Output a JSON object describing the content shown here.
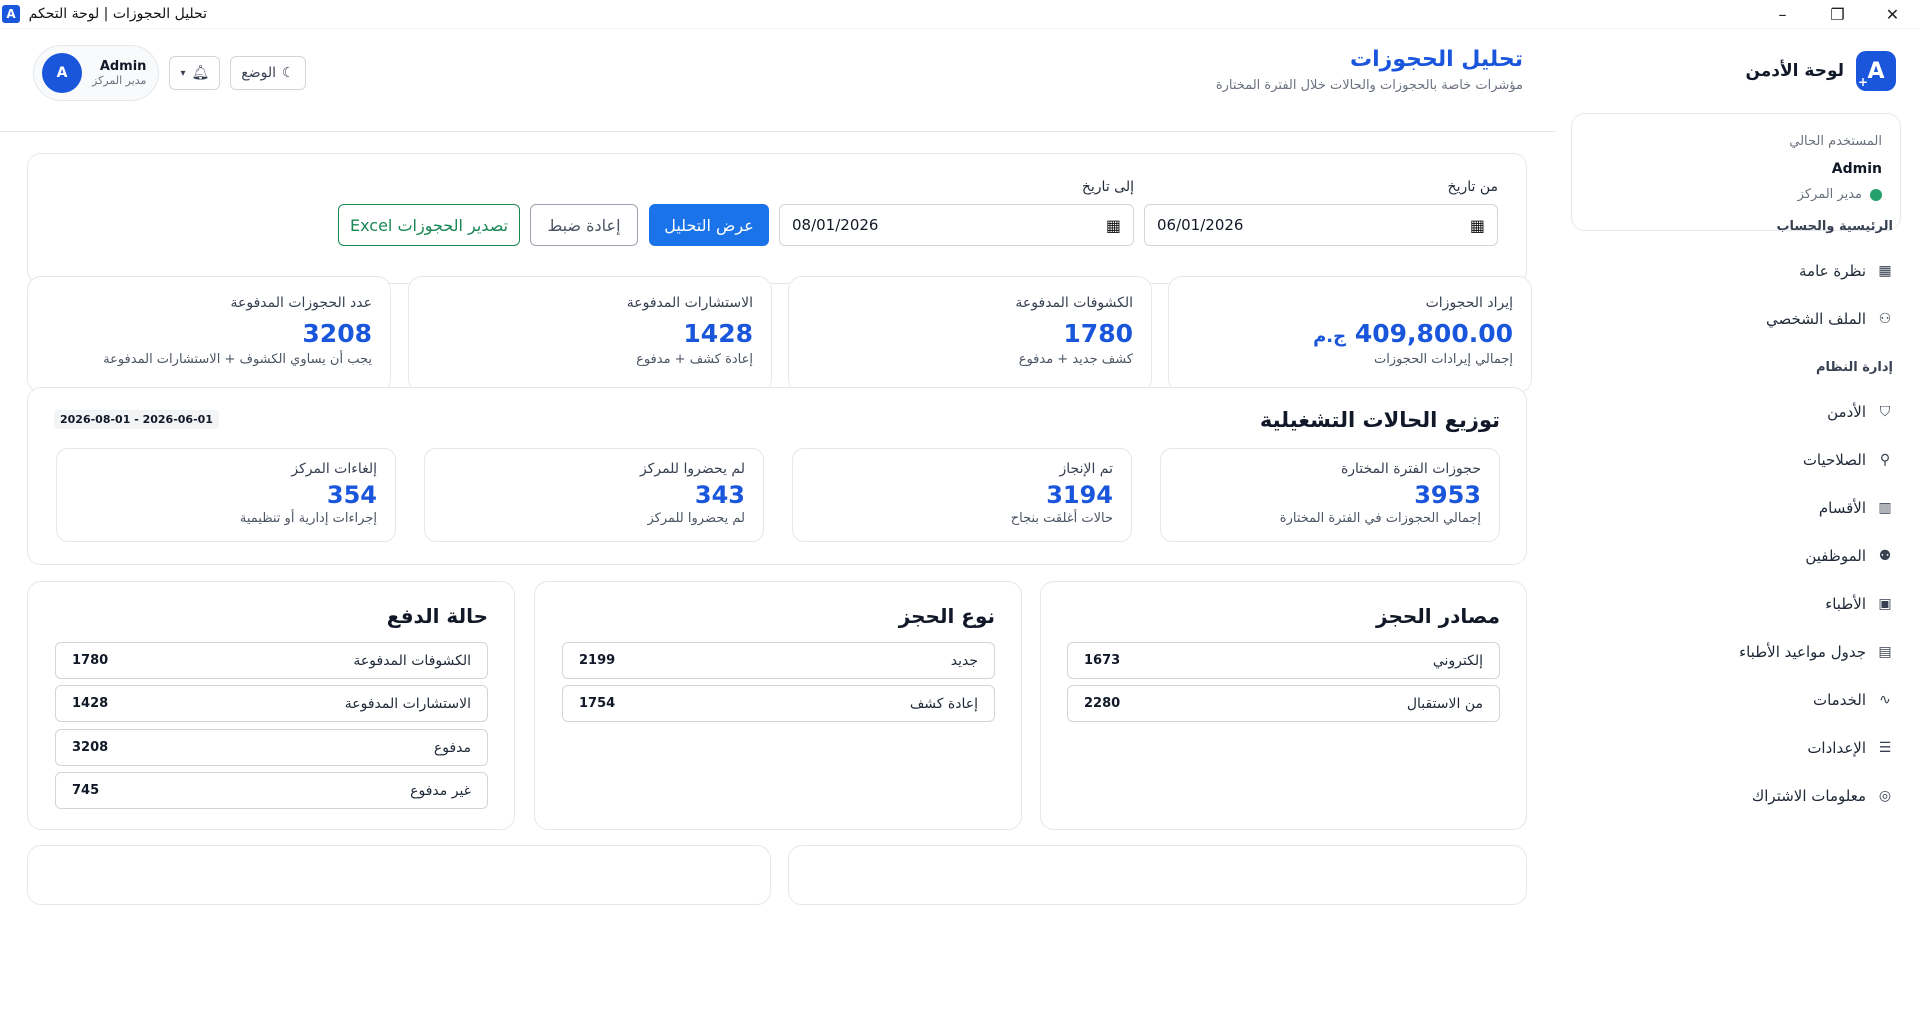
{
  "window": {
    "title": "تحليل الحجوزات | لوحة التحكم",
    "app_icon": "A",
    "minimize": "–",
    "restore": "❐",
    "close": "✕"
  },
  "sidebar": {
    "brand": "لوحة الأدمن",
    "brand_logo": "A",
    "brand_logo_plus": "+",
    "user_card": {
      "label": "المستخدم الحالي",
      "name": "Admin",
      "role": "مدير المركز"
    },
    "sections": [
      {
        "title": "الرئيسية والحساب"
      },
      {
        "title": "إدارة النظام"
      }
    ],
    "items": [
      {
        "label": "نظرة عامة",
        "icon": "grid-icon"
      },
      {
        "label": "الملف الشخصي",
        "icon": "user-icon"
      },
      {
        "label": "الأدمن",
        "icon": "shield-icon"
      },
      {
        "label": "الصلاحيات",
        "icon": "hierarchy-icon"
      },
      {
        "label": "الأقسام",
        "icon": "building-icon"
      },
      {
        "label": "الموظفين",
        "icon": "users-icon"
      },
      {
        "label": "الأطباء",
        "icon": "id-badge-icon"
      },
      {
        "label": "جدول مواعيد الأطباء",
        "icon": "calendar-icon"
      },
      {
        "label": "الخدمات",
        "icon": "pulse-icon"
      },
      {
        "label": "الإعدادات",
        "icon": "sliders-icon"
      },
      {
        "label": "معلومات الاشتراك",
        "icon": "check-circle-icon"
      }
    ]
  },
  "header": {
    "title": "تحليل الحجوزات",
    "subtitle": "مؤشرات خاصة بالحجوزات والحالات خلال الفترة المختارة",
    "theme_label": "الوضع",
    "profile": {
      "initial": "A",
      "name": "Admin",
      "role": "مدير المركز"
    }
  },
  "filters": {
    "from_label": "من تاريخ",
    "to_label": "إلى تاريخ",
    "from_value": "06/01/2026",
    "to_value": "08/01/2026",
    "analyze_label": "عرض التحليل",
    "reset_label": "إعادة ضبط",
    "export_label": "تصدير الحجوزات Excel"
  },
  "kpis": [
    {
      "label": "إيراد الحجوزات",
      "value": "409,800.00",
      "currency": "ج.م",
      "note": "إجمالي إيرادات الحجوزات"
    },
    {
      "label": "الكشوفات المدفوعة",
      "value": "1780",
      "note": "كشف جديد + مدفوع"
    },
    {
      "label": "الاستشارات المدفوعة",
      "value": "1428",
      "note": "إعادة كشف + مدفوع"
    },
    {
      "label": "عدد الحجوزات المدفوعة",
      "value": "3208",
      "note": "يجب أن يساوي الكشوف + الاستشارات المدفوعة"
    }
  ],
  "status": {
    "title": "توزيع الحالات التشغيلية",
    "range": "2026-08-01 - 2026-06-01",
    "items": [
      {
        "label": "حجوزات الفترة المختارة",
        "value": "3953",
        "note": "إجمالي الحجوزات في الفترة المختارة"
      },
      {
        "label": "تم الإنجاز",
        "value": "3194",
        "note": "حالات أغلقت بنجاح"
      },
      {
        "label": "لم يحضروا للمركز",
        "value": "343",
        "note": "لم يحضروا للمركز"
      },
      {
        "label": "إلغاءات المركز",
        "value": "354",
        "note": "إجراءات إدارية أو تنظيمية"
      }
    ]
  },
  "sources": {
    "title": "مصادر الحجز",
    "rows": [
      {
        "label": "إلكتروني",
        "value": "1673"
      },
      {
        "label": "من الاستقبال",
        "value": "2280"
      }
    ]
  },
  "types": {
    "title": "نوع الحجز",
    "rows": [
      {
        "label": "جديد",
        "value": "2199"
      },
      {
        "label": "إعادة كشف",
        "value": "1754"
      }
    ]
  },
  "payment": {
    "title": "حالة الدفع",
    "rows": [
      {
        "label": "الكشوفات المدفوعة",
        "value": "1780"
      },
      {
        "label": "الاستشارات المدفوعة",
        "value": "1428"
      },
      {
        "label": "مدفوع",
        "value": "3208"
      },
      {
        "label": "غير مدفوع",
        "value": "745"
      }
    ]
  },
  "colors": {
    "accent": "#1a56db",
    "primary_button": "#1a73e8",
    "export_green": "#198754",
    "status_dot": "#22a06b"
  }
}
